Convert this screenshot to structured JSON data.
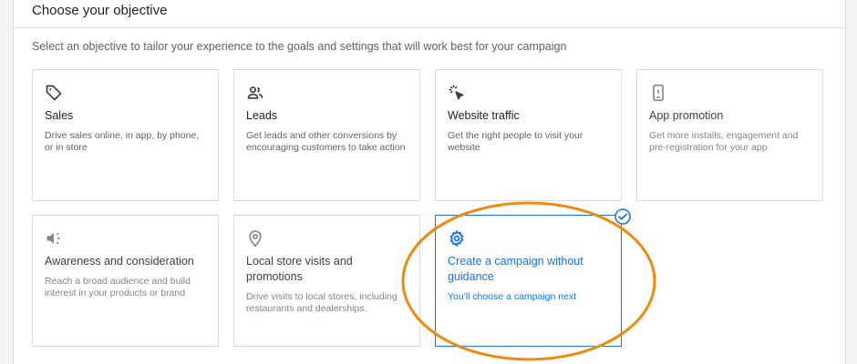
{
  "header": {
    "title": "Choose your objective"
  },
  "subtitle": "Select an objective to tailor your experience to the goals and settings that will work best for your campaign",
  "cards": [
    {
      "icon": "tag-icon",
      "title": "Sales",
      "description": "Drive sales online, in app, by phone, or in store"
    },
    {
      "icon": "people-icon",
      "title": "Leads",
      "description": "Get leads and other conversions by encouraging customers to take action"
    },
    {
      "icon": "cursor-click-icon",
      "title": "Website traffic",
      "description": "Get the right people to visit your website"
    },
    {
      "icon": "phone-icon",
      "title": "App promotion",
      "description": "Get more installs, engagement and pre-registration for your app"
    },
    {
      "icon": "megaphone-icon",
      "title": "Awareness and consideration",
      "description": "Reach a broad audience and build interest in your products or brand"
    },
    {
      "icon": "location-pin-icon",
      "title": "Local store visits and promotions",
      "description": "Drive visits to local stores, including restaurants and dealerships."
    },
    {
      "icon": "gear-icon",
      "title": "Create a campaign without guidance",
      "description": "You'll choose a campaign next",
      "selected": true
    }
  ],
  "colors": {
    "accent": "#1a73e8",
    "highlight_circle": "#f08a0b"
  }
}
